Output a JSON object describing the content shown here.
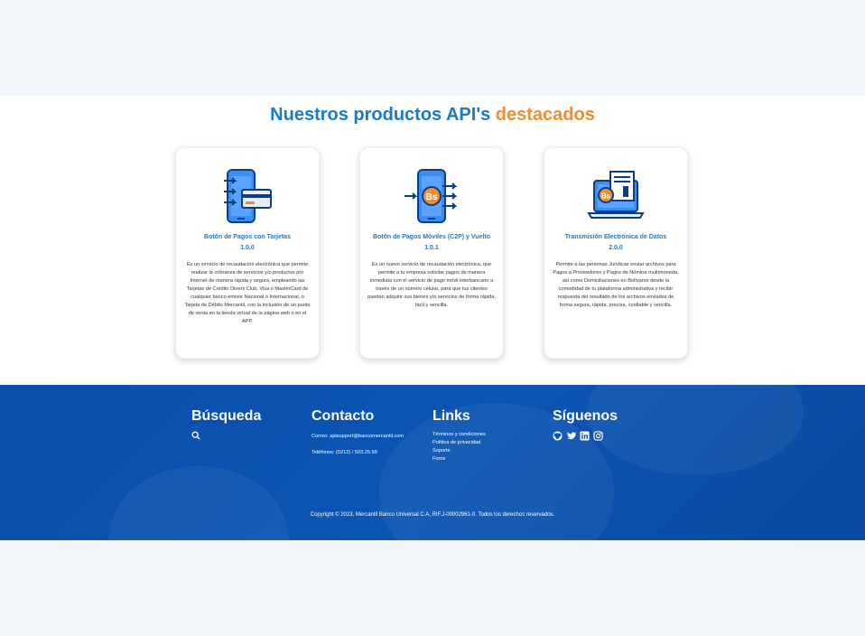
{
  "section": {
    "title_main": "Nuestros productos API's",
    "title_accent": "destacados"
  },
  "cards": [
    {
      "icon": "card-payment-phone-icon",
      "title": "Botón de Pagos con Tarjetas",
      "version": "1.0.0",
      "description": "Es un servicio de recaudación electrónica que permite realizar la cobranza de servicios y/o productos por Internet de manera rápida y segura, empleando las Tarjetas de Crédito Diners Club, Visa o MasterCard de cualquier banco emisor Nacional o Internacional, o Tarjeta de Débito Mercantil, con la inclusión de un punto de venta en la tienda virtual de la página web o en el APP."
    },
    {
      "icon": "mobile-payment-bs-icon",
      "title": "Botón de Pagos Móviles (C2P) y Vuelto",
      "version": "1.0.1",
      "description": "Es un nuevo servicio de recaudación electrónica, que permite a tu empresa solicitar pagos de manera inmediata con el servicio de pago móvil interbancario a través de un número celular, para que tus clientes puedan adquirir sus bienes y/o servicios de forma rápida, fácil y sencilla."
    },
    {
      "icon": "laptop-data-transfer-icon",
      "title": "Transmisión Electrónica de Datos",
      "version": "2.0.0",
      "description": "Permite a las personas Jurídicas enviar archivos para Pagos a Proveedores y Pagos de Nómina multimoneda, así como Domiciliaciones en Bolívares desde la comodidad de tu plataforma administrativa y recibir respuesta del resultado de los archivos enviados de forma segura, rápida, precisa, confiable y sencilla."
    }
  ],
  "footer": {
    "search_title": "Búsqueda",
    "contact_title": "Contacto",
    "contact_email": "Correo: apisupport@bancomercantil.com",
    "contact_phone": "Teléfonos: (0212) / 503.25.99",
    "links_title": "Links",
    "links": [
      "Términos y condiciones",
      "Política de privacidad",
      "Soporte",
      "Foros"
    ],
    "social_title": "Síguenos",
    "social_icons": [
      "github-icon",
      "twitter-icon",
      "linkedin-icon",
      "instagram-icon"
    ],
    "copyright": "Copyright © 2023, Mercantil Banco Universal C.A, RIF.J-00002961-0. Todos los derechos reservados."
  },
  "colors": {
    "primary": "#1a7bc4",
    "accent": "#f48c2a",
    "footer_bg": "#0b55b3",
    "page_bg": "#f2f6fb"
  }
}
